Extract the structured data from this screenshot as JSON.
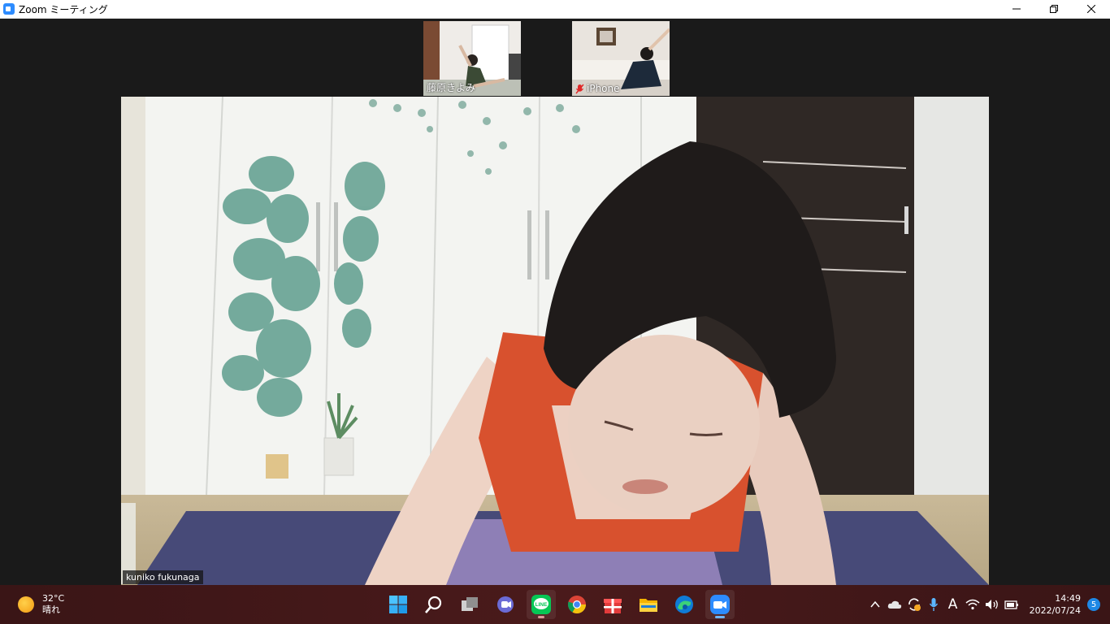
{
  "window": {
    "title": "Zoom ミーティング"
  },
  "participants": {
    "thumb1": {
      "name": "藤原きよみ"
    },
    "thumb2": {
      "name": "iPhone",
      "muted": true
    },
    "main": {
      "name": "kuniko fukunaga"
    }
  },
  "taskbar": {
    "weather": {
      "temp": "32°C",
      "condition": "晴れ"
    },
    "apps": [
      "start-icon",
      "search-icon",
      "task-view-icon",
      "teams-chat-icon",
      "line-icon",
      "chrome-icon",
      "gift-icon",
      "file-explorer-icon",
      "edge-icon",
      "zoom-icon"
    ],
    "clock": {
      "time": "14:49",
      "date": "2022/07/24"
    },
    "notifications": "5",
    "ime": "A"
  },
  "colors": {
    "zoom_blue": "#2d8cff",
    "taskbar": "#3f1718",
    "stage": "#1a1a1a",
    "accent_orange": "#f39a12"
  }
}
